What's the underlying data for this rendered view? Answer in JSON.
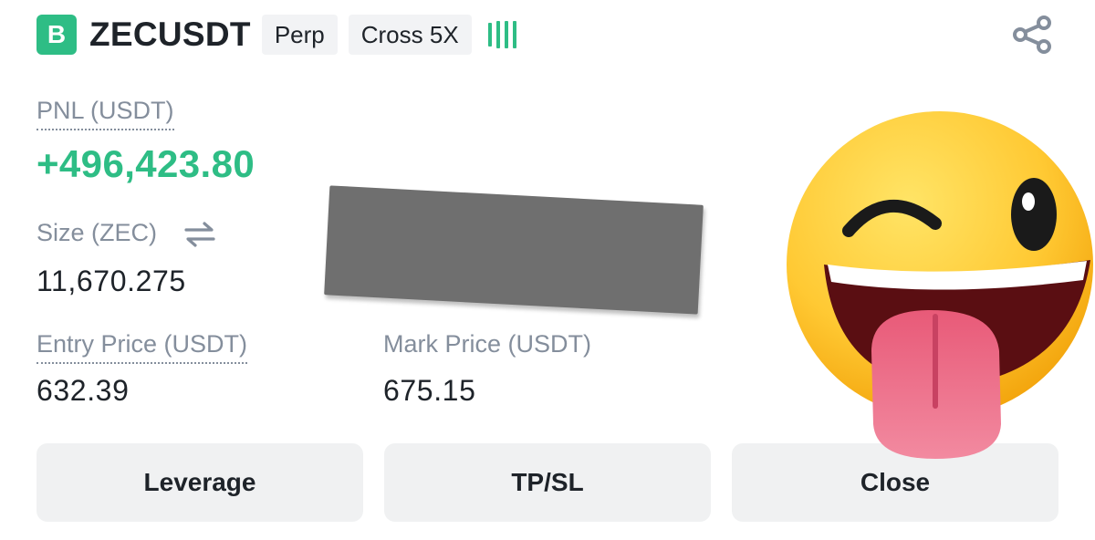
{
  "header": {
    "exchange_badge": "B",
    "symbol": "ZECUSDT",
    "tags": [
      "Perp",
      "Cross 5X"
    ],
    "signal_icon": "signal-bars-icon",
    "share_icon": "share-icon"
  },
  "position": {
    "pnl_label": "PNL (USDT)",
    "pnl_value": "+496,423.80",
    "size_label": "Size (ZEC)",
    "size_value": "11,670.275",
    "entry_label": "Entry Price (USDT)",
    "entry_value": "632.39",
    "mark_label": "Mark Price (USDT)",
    "mark_value": "675.15"
  },
  "buttons": {
    "leverage": "Leverage",
    "tpsl": "TP/SL",
    "close": "Close"
  },
  "colors": {
    "accent_green": "#2ebd85",
    "label_gray": "#848e9c",
    "button_bg": "#f0f1f2"
  },
  "overlays": {
    "emoji": "winking-face-with-tongue",
    "redaction": "gray-redaction-bar"
  }
}
